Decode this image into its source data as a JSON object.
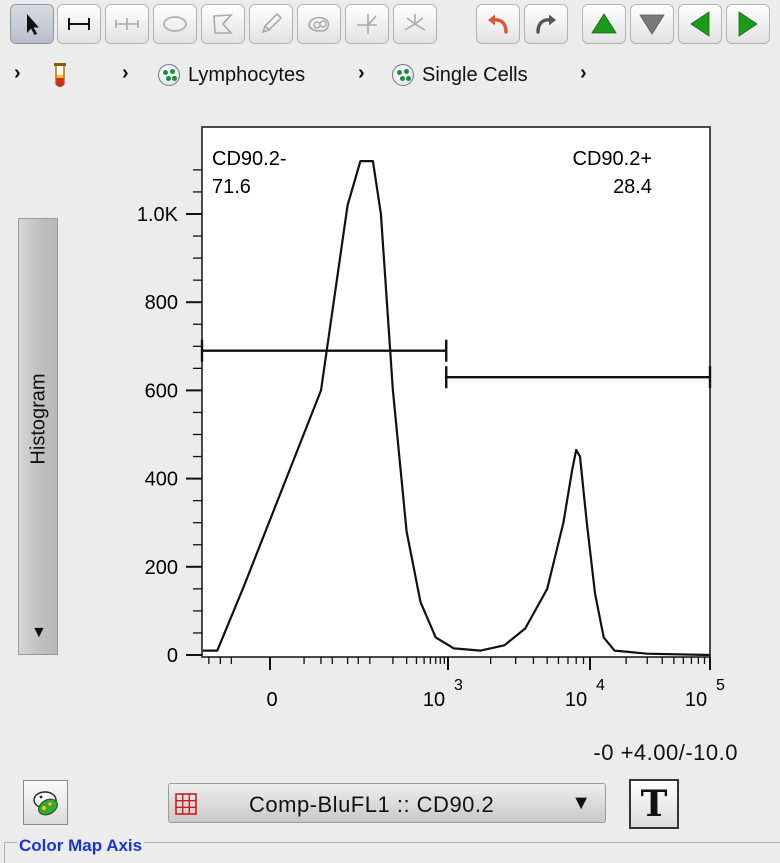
{
  "toolbar": {
    "tools": [
      "select-pointer",
      "range-gate",
      "bisector-gate",
      "ellipse-gate",
      "polygon-gate",
      "freehand-gate",
      "spline-gate",
      "quadrant-gate",
      "web-gate"
    ],
    "actions": [
      "undo",
      "redo",
      "move-up",
      "move-down",
      "move-left",
      "move-right"
    ],
    "accent_green": "#1a9b1a",
    "undo_color": "#e0552b"
  },
  "breadcrumb": {
    "items": [
      "Lymphocytes",
      "Single Cells"
    ]
  },
  "side_tab": {
    "label": "Histogram",
    "arrow": "▼"
  },
  "chart_data": {
    "type": "line",
    "x_scale": "biexponential",
    "y_ticks": [
      {
        "value": 0,
        "label": "0"
      },
      {
        "value": 200,
        "label": "200"
      },
      {
        "value": 400,
        "label": "400"
      },
      {
        "value": 600,
        "label": "600"
      },
      {
        "value": 800,
        "label": "800"
      },
      {
        "value": 1000,
        "label": "1.0K"
      }
    ],
    "ylim": [
      0,
      1150
    ],
    "x_ticks": [
      {
        "value": 0,
        "label": "0",
        "exp": ""
      },
      {
        "value": 1000,
        "label": "10",
        "exp": "3"
      },
      {
        "value": 10000,
        "label": "10",
        "exp": "4"
      },
      {
        "value": 100000,
        "label": "10",
        "exp": "5"
      }
    ],
    "series": [
      {
        "points": [
          [
            -300,
            10
          ],
          [
            -120,
            10
          ],
          [
            -20,
            160
          ],
          [
            20,
            600
          ],
          [
            50,
            1020
          ],
          [
            75,
            1120
          ],
          [
            110,
            1120
          ],
          [
            140,
            1000
          ],
          [
            200,
            600
          ],
          [
            300,
            280
          ],
          [
            450,
            120
          ],
          [
            700,
            40
          ],
          [
            1100,
            15
          ],
          [
            1700,
            10
          ],
          [
            2500,
            22
          ],
          [
            3500,
            60
          ],
          [
            5000,
            150
          ],
          [
            6500,
            300
          ],
          [
            7500,
            420
          ],
          [
            8000,
            465
          ],
          [
            8500,
            450
          ],
          [
            9500,
            300
          ],
          [
            11000,
            140
          ],
          [
            13000,
            40
          ],
          [
            16000,
            10
          ],
          [
            30000,
            3
          ],
          [
            100000,
            0
          ]
        ]
      }
    ],
    "gates": [
      {
        "name": "CD90.2-",
        "percent": "71.6",
        "x_from": -300,
        "x_to": 950,
        "y": 690
      },
      {
        "name": "CD90.2+",
        "percent": "28.4",
        "x_from": 950,
        "x_to": 100000,
        "y": 630
      }
    ]
  },
  "transform_readout": "-0 +4.00/-10.0",
  "parameter": {
    "selected": "Comp-BluFL1 :: CD90.2",
    "arrow": "▼"
  },
  "text_button": {
    "label": "T"
  },
  "color_map": {
    "label": "Color Map Axis"
  }
}
